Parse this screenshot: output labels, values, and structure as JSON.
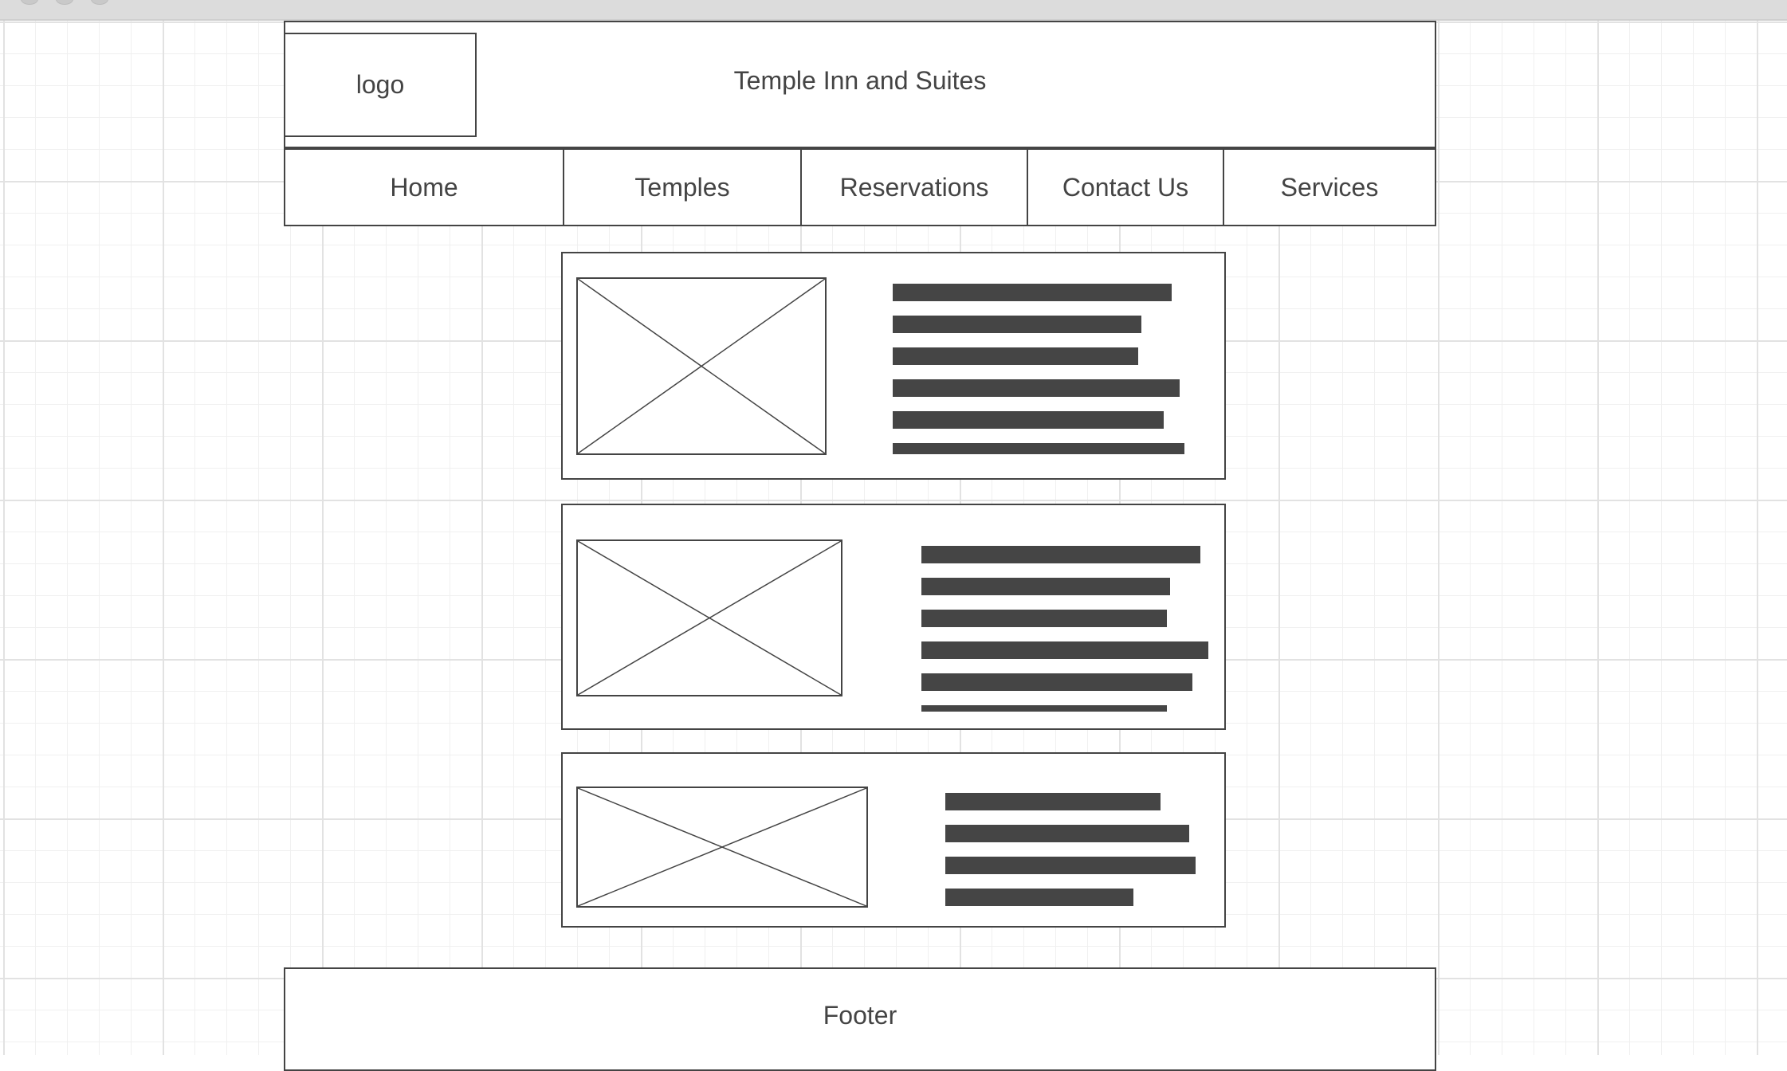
{
  "header": {
    "logo_label": "logo",
    "site_title": "Temple Inn and Suites"
  },
  "nav": {
    "items": [
      {
        "label": "Home"
      },
      {
        "label": "Temples"
      },
      {
        "label": "Reservations"
      },
      {
        "label": "Contact Us"
      },
      {
        "label": "Services"
      }
    ]
  },
  "content": {
    "cards": [
      {
        "image_placeholder": "image-placeholder-icon",
        "text_lines": 6
      },
      {
        "image_placeholder": "image-placeholder-icon",
        "text_lines": 6
      },
      {
        "image_placeholder": "image-placeholder-icon",
        "text_lines": 4
      }
    ]
  },
  "footer": {
    "label": "Footer"
  },
  "colors": {
    "stroke": "#444444",
    "text_bar": "#454545",
    "grid_minor": "#f0f0f0",
    "grid_major": "#e2e2e2"
  }
}
